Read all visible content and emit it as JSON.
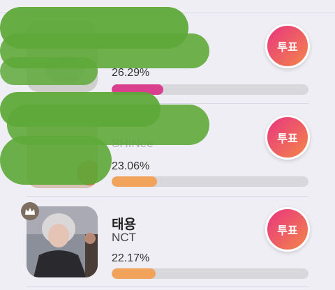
{
  "entries": [
    {
      "name": "",
      "group": "",
      "percent": "26.29%",
      "fraction": 0.2629,
      "bar_color": "#d93e8f",
      "vote_label": "투표",
      "rank_crown": false
    },
    {
      "name": "",
      "group": "SHINee",
      "percent": "23.06%",
      "fraction": 0.2306,
      "bar_color": "#f1a35b",
      "vote_label": "투표",
      "rank_crown": false
    },
    {
      "name": "태용",
      "group": "NCT",
      "percent": "22.17%",
      "fraction": 0.2217,
      "bar_color": "#f1a35b",
      "vote_label": "투표",
      "rank_crown": true
    }
  ],
  "colors": {
    "vote_gradient_start": "#e8357f",
    "vote_gradient_end": "#f3864a",
    "bar_track": "#d8d8dc",
    "redaction": "#5ea93a"
  },
  "icons": {
    "crown": "crown-icon"
  }
}
